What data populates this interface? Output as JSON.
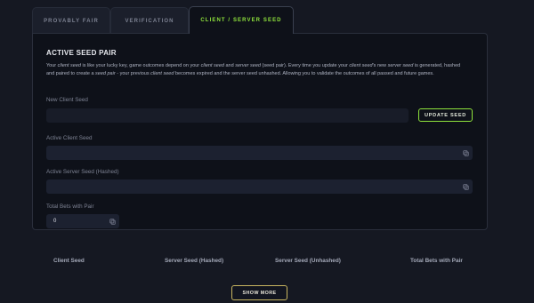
{
  "tabs": [
    {
      "label": "PROVABLY FAIR"
    },
    {
      "label": "VERIFICATION"
    },
    {
      "label": "CLIENT / SERVER SEED"
    }
  ],
  "panel": {
    "title": "ACTIVE SEED PAIR",
    "description": {
      "p1": "Your ",
      "e1": "client seed",
      "p2": " is like your lucky key, game outcomes depend on your ",
      "e2": "client seed",
      "p3": " and ",
      "e3": "server seed",
      "p4": " (seed pair). Every time you update your ",
      "e4": "client seed",
      "p5": "'s new ",
      "e5": "server seed",
      "p6": " is generated, hashed and paired to create a ",
      "e6": "seed pair",
      "p7": " - your previous ",
      "e7": "client seed",
      "p8": " becomes expired and the server seed unhashed. Allowing you to validate the outcomes of all passed and future games."
    },
    "new_client_seed": {
      "label": "New Client Seed",
      "value": "",
      "placeholder": ""
    },
    "update_button": "UPDATE SEED",
    "active_client_seed": {
      "label": "Active Client Seed",
      "value": ""
    },
    "active_server_seed": {
      "label": "Active Server Seed (Hashed)",
      "value": ""
    },
    "total_bets": {
      "label": "Total Bets with Pair",
      "value": "0"
    }
  },
  "history": {
    "columns": [
      "Client Seed",
      "Server Seed (Hashed)",
      "Server Seed (Unhashed)",
      "Total Bets with Pair"
    ]
  },
  "show_more": "SHOW MORE",
  "colors": {
    "accent_green": "#8fe33c",
    "accent_gold": "#c8b560",
    "background": "#151822",
    "panel": "#0e1119"
  },
  "icons": {
    "copy": "copy-icon"
  }
}
